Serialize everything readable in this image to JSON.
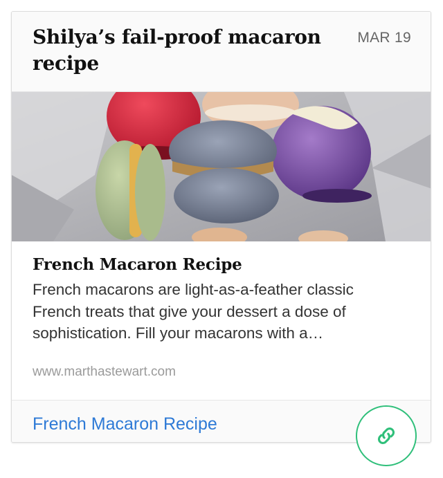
{
  "card": {
    "title": "Shilya’s fail-proof macaron recipe",
    "date": "MAR 19"
  },
  "link_preview": {
    "title": "French Macaron Recipe",
    "description": "French macarons are light-as-a-feather classic French treats that give your dessert a dose of sophistication. Fill your macarons with a…",
    "domain": "www.marthastewart.com"
  },
  "footer": {
    "link_text": "French Macaron Recipe"
  },
  "icons": {
    "fab": "link-icon"
  },
  "colors": {
    "link": "#2e7ad6",
    "fab_accent": "#2fbf7a",
    "title_text": "#111111"
  }
}
